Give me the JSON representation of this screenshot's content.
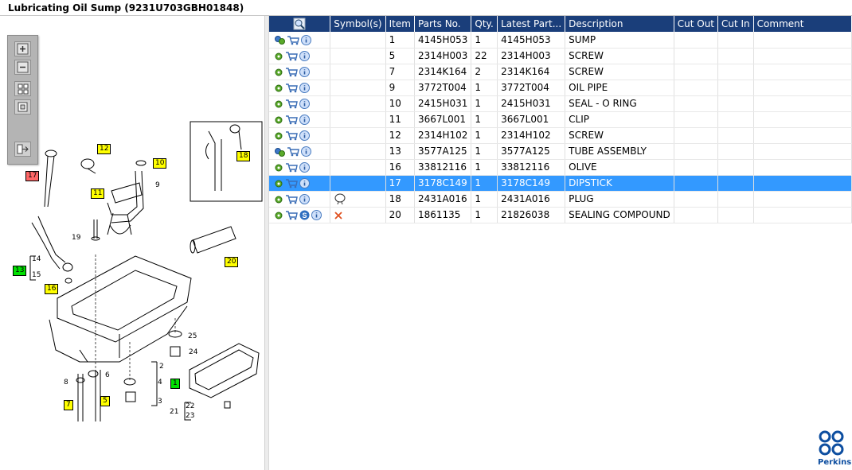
{
  "window": {
    "title": "Lubricating Oil Sump (9231U703GBH01848)"
  },
  "toolbox": {
    "buttons": [
      {
        "name": "zoom-in-icon"
      },
      {
        "name": "zoom-out-icon"
      },
      {
        "name": "fit-all-icon"
      },
      {
        "name": "fit-window-icon"
      },
      {
        "name": "export-icon"
      }
    ]
  },
  "grid": {
    "columns": [
      "",
      "Symbol(s)",
      "Item",
      "Parts No.",
      "Qty.",
      "Latest Part...",
      "Description",
      "Cut Out",
      "Cut In",
      "Comment"
    ],
    "rows": [
      {
        "icons": [
          "assembly-gear-icon",
          "cart-icon",
          "info-icon"
        ],
        "symbol": "",
        "item": "1",
        "part": "4145H053",
        "qty": "1",
        "latest": "4145H053",
        "desc": "SUMP",
        "selected": false
      },
      {
        "icons": [
          "gear-icon",
          "cart-icon",
          "info-icon"
        ],
        "symbol": "",
        "item": "5",
        "part": "2314H003",
        "qty": "22",
        "latest": "2314H003",
        "desc": "SCREW",
        "selected": false
      },
      {
        "icons": [
          "gear-icon",
          "cart-icon",
          "info-icon"
        ],
        "symbol": "",
        "item": "7",
        "part": "2314K164",
        "qty": "2",
        "latest": "2314K164",
        "desc": "SCREW",
        "selected": false
      },
      {
        "icons": [
          "gear-icon",
          "cart-icon",
          "info-icon"
        ],
        "symbol": "",
        "item": "9",
        "part": "3772T004",
        "qty": "1",
        "latest": "3772T004",
        "desc": "OIL PIPE",
        "selected": false
      },
      {
        "icons": [
          "gear-icon",
          "cart-icon",
          "info-icon"
        ],
        "symbol": "",
        "item": "10",
        "part": "2415H031",
        "qty": "1",
        "latest": "2415H031",
        "desc": "SEAL - O RING",
        "selected": false
      },
      {
        "icons": [
          "gear-icon",
          "cart-icon",
          "info-icon"
        ],
        "symbol": "",
        "item": "11",
        "part": "3667L001",
        "qty": "1",
        "latest": "3667L001",
        "desc": "CLIP",
        "selected": false
      },
      {
        "icons": [
          "gear-icon",
          "cart-icon",
          "info-icon"
        ],
        "symbol": "",
        "item": "12",
        "part": "2314H102",
        "qty": "1",
        "latest": "2314H102",
        "desc": "SCREW",
        "selected": false
      },
      {
        "icons": [
          "assembly-gear-icon",
          "cart-icon",
          "info-icon"
        ],
        "symbol": "",
        "item": "13",
        "part": "3577A125",
        "qty": "1",
        "latest": "3577A125",
        "desc": "TUBE ASSEMBLY",
        "selected": false
      },
      {
        "icons": [
          "gear-icon",
          "cart-icon",
          "info-icon"
        ],
        "symbol": "",
        "item": "16",
        "part": "33812116",
        "qty": "1",
        "latest": "33812116",
        "desc": "OLIVE",
        "selected": false
      },
      {
        "icons": [
          "gear-icon",
          "cart-icon",
          "info-icon"
        ],
        "symbol": "",
        "item": "17",
        "part": "3178C149",
        "qty": "1",
        "latest": "3178C149",
        "desc": "DIPSTICK",
        "selected": true
      },
      {
        "icons": [
          "gear-icon",
          "cart-icon",
          "info-icon"
        ],
        "symbol": "bulb-symbol-icon",
        "item": "18",
        "part": "2431A016",
        "qty": "1",
        "latest": "2431A016",
        "desc": "PLUG",
        "selected": false
      },
      {
        "icons": [
          "gear-icon",
          "cart-icon",
          "service-icon",
          "info-icon"
        ],
        "symbol": "cross-symbol-icon",
        "item": "20",
        "part": "1861135",
        "qty": "1",
        "latest": "21826038",
        "desc": "SEALING COMPOUND",
        "selected": false
      }
    ]
  },
  "callouts": {
    "c1": "1",
    "c2": "2",
    "c3": "3",
    "c4": "4",
    "c5": "5",
    "c6": "6",
    "c7": "7",
    "c8": "8",
    "c9": "9",
    "c10": "10",
    "c11": "11",
    "c12": "12",
    "c13": "13",
    "c14": "14",
    "c15": "15",
    "c16": "16",
    "c17": "17",
    "c18": "18",
    "c19": "19",
    "c20": "20",
    "c21": "21",
    "c22": "22",
    "c23": "23",
    "c24": "24",
    "c25": "25"
  },
  "colors": {
    "header": "#1a3e7a",
    "selected": "#3399ff",
    "callout_yellow": "#ffff00",
    "callout_green": "#00e000",
    "callout_red": "#ff6666",
    "brand": "#0d4ea0"
  },
  "brand": {
    "name": "Perkins"
  }
}
